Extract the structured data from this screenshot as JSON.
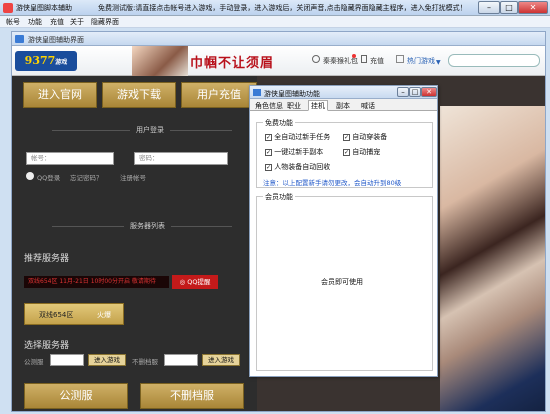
{
  "window": {
    "title": "游侠皇图脚本辅助",
    "notice": "免费测试版:请直接点击帐号进入游戏，手动登录，进入游戏后，关闭声音,点击隐藏界面隐藏主程序，进入免打扰模式！"
  },
  "menu": [
    "帐号",
    "功能",
    "充值",
    "关于",
    "隐藏界面"
  ],
  "inner": {
    "title": "游侠皇图辅助界面",
    "logo": "9377",
    "logo_sub": "游戏",
    "slogan": "巾帼不让须眉",
    "top_links": [
      "秦秦猴礼包",
      "充值",
      "热门游戏"
    ],
    "nav_buttons": [
      "进入官网",
      "游戏下载",
      "用户充值"
    ],
    "login_section": "用户登录",
    "account_placeholder": "帐号：",
    "password_placeholder": "密码：",
    "login_links": [
      "QQ登录",
      "忘记密码？",
      "注册帐号"
    ],
    "server_section": "服务器列表",
    "recommend_title": "推荐服务器",
    "recommend_line": "双线654区  11月-21日 10时00分开启  敬请期待",
    "qq_tip": "QQ提醒",
    "recommended_server": "双线654区",
    "recommended_status": "火爆",
    "select_title": "选择服务器",
    "test_label": "公测服",
    "enter_label": "进入游戏",
    "nodelete_label": "不删档服",
    "enter_label2": "进入游戏",
    "bottom_buttons": [
      "公测服",
      "不删档服"
    ]
  },
  "dialog": {
    "title": "游侠皇图辅助功能",
    "tabs": [
      "角色信息",
      "职业",
      "挂机",
      "副本",
      "喊话"
    ],
    "active_tab": "挂机",
    "free_group": "免费功能",
    "options": [
      {
        "label": "全自动过新手任务",
        "checked": true
      },
      {
        "label": "自动穿装备",
        "checked": true
      },
      {
        "label": "一键过新手副本",
        "checked": true
      },
      {
        "label": "自动捕宠",
        "checked": true
      },
      {
        "label": "人物装备自动回收",
        "checked": true
      }
    ],
    "note": "注意：以上配置新手请勿更改，会自动升到80级",
    "member_group": "会员功能",
    "member_text": "会员即可使用"
  }
}
